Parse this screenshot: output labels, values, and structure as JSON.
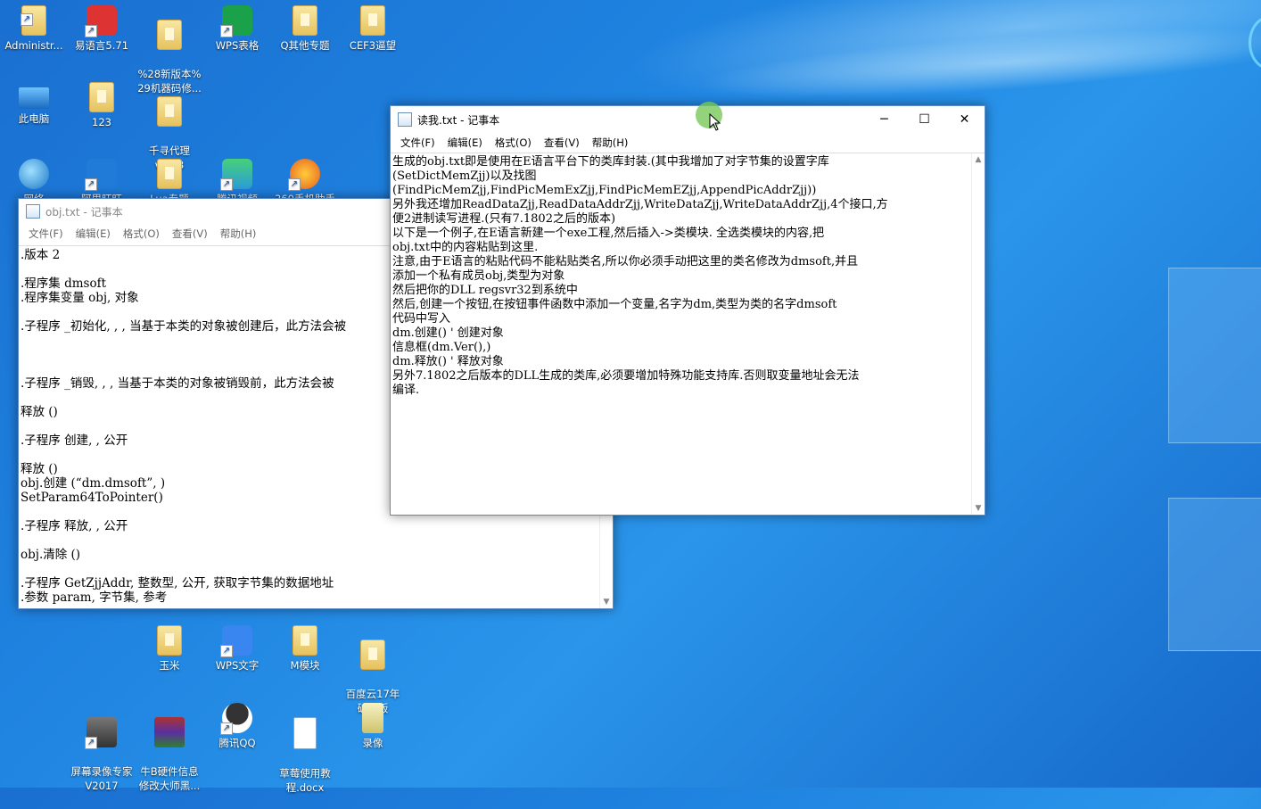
{
  "desktop_icons": [
    {
      "label": "Administr...",
      "icon": "user-folder-icon"
    },
    {
      "label": "易语言5.71",
      "icon": "eyuyan-icon"
    },
    {
      "label": "%28新版本%\n29机器码修...",
      "icon": "folder-icon"
    },
    {
      "label": "WPS表格",
      "icon": "wps-sheet-icon"
    },
    {
      "label": "Q其他专题",
      "icon": "folder-icon"
    },
    {
      "label": "CEF3逼望",
      "icon": "folder-icon"
    },
    {
      "label": "此电脑",
      "icon": "computer-icon"
    },
    {
      "label": "123",
      "icon": "folder-icon"
    },
    {
      "label": "千寻代理\nv7.98",
      "icon": "folder-icon"
    },
    {
      "label": "网络",
      "icon": "network-icon"
    },
    {
      "label": "阿里旺旺",
      "icon": "aliwangwang-icon"
    },
    {
      "label": "Lua专题",
      "icon": "folder-icon"
    },
    {
      "label": "腾讯视频",
      "icon": "tencent-video-icon"
    },
    {
      "label": "360手机助手",
      "icon": "360-icon"
    },
    {
      "label": "玉米",
      "icon": "folder-icon"
    },
    {
      "label": "WPS文字",
      "icon": "wps-writer-icon"
    },
    {
      "label": "M模块",
      "icon": "folder-icon"
    },
    {
      "label": "百度云17年\n破解版",
      "icon": "folder-icon"
    },
    {
      "label": "屏幕录像专家\nV2017",
      "icon": "screen-recorder-icon"
    },
    {
      "label": "牛B硬件信息\n修改大师黑...",
      "icon": "winrar-icon"
    },
    {
      "label": "腾讯QQ",
      "icon": "qq-icon"
    },
    {
      "label": "草莓使用教\n程.docx",
      "icon": "word-doc-icon"
    },
    {
      "label": "录像",
      "icon": "video-file-icon"
    }
  ],
  "window_obj": {
    "title": "obj.txt - 记事本",
    "menus": [
      "文件(F)",
      "编辑(E)",
      "格式(O)",
      "查看(V)",
      "帮助(H)"
    ],
    "content": ".版本 2\n\n.程序集 dmsoft\n.程序集变量 obj, 对象\n\n.子程序 _初始化, , , 当基于本类的对象被创建后，此方法会被\n\n\n\n.子程序 _销毁, , , 当基于本类的对象被销毁前，此方法会被\n\n释放 ()\n\n.子程序 创建, , 公开\n\n释放 ()\nobj.创建 (“dm.dmsoft”, )\nSetParam64ToPointer()\n\n.子程序 释放, , 公开\n\nobj.清除 ()\n\n.子程序 GetZjjAddr, 整数型, 公开, 获取字节集的数据地址\n.参数 param, 字节集, 参考"
  },
  "window_read": {
    "title": "读我.txt - 记事本",
    "menus": [
      "文件(F)",
      "编辑(E)",
      "格式(O)",
      "查看(V)",
      "帮助(H)"
    ],
    "content": "生成的obj.txt即是使用在E语言平台下的类库封装.(其中我增加了对字节集的设置字库\n(SetDictMemZjj)以及找图\n(FindPicMemZjj,FindPicMemExZjj,FindPicMemEZjj,AppendPicAddrZjj))\n另外我还增加ReadDataZjj,ReadDataAddrZjj,WriteDataZjj,WriteDataAddrZjj,4个接口,方\n便2进制读写进程.(只有7.1802之后的版本)\n以下是一个例子,在E语言新建一个exe工程,然后插入->类模块. 全选类模块的内容,把\nobj.txt中的内容粘贴到这里.\n注意,由于E语言的粘贴代码不能粘贴类名,所以你必须手动把这里的类名修改为dmsoft,并且\n添加一个私有成员obj,类型为对象\n然后把你的DLL regsvr32到系统中\n然后,创建一个按钮,在按钮事件函数中添加一个变量,名字为dm,类型为类的名字dmsoft\n代码中写入\ndm.创建() ' 创建对象\n信息框(dm.Ver(),)\ndm.释放() ' 释放对象\n另外7.1802之后版本的DLL生成的类库,必须要增加特殊功能支持库.否则取变量地址会无法\n编译."
  },
  "window_controls": {
    "minimize": "─",
    "maximize": "☐",
    "close": "✕"
  }
}
